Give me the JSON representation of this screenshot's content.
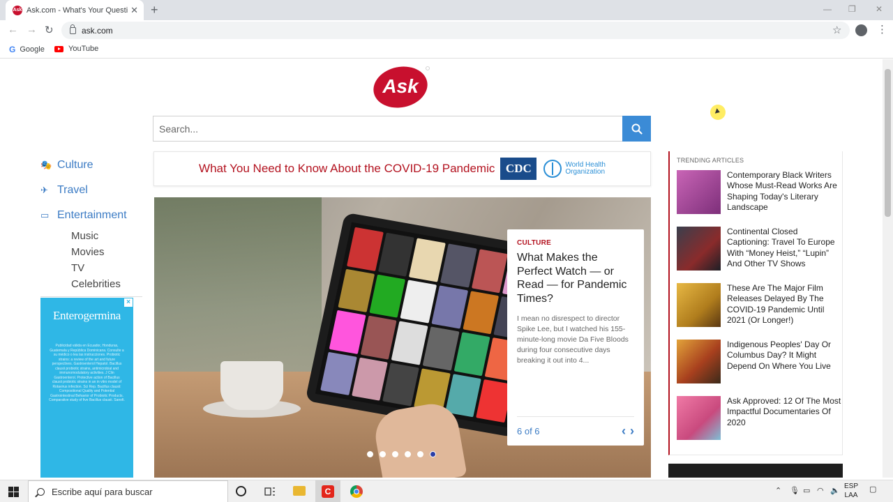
{
  "browser": {
    "tab_title": "Ask.com - What's Your Question?",
    "url": "ask.com",
    "bookmarks": [
      "Google",
      "YouTube"
    ]
  },
  "search": {
    "placeholder": "Search..."
  },
  "logo": {
    "text": "Ask"
  },
  "nav": {
    "items": [
      {
        "label": "Culture",
        "icon": "masks-icon"
      },
      {
        "label": "Travel",
        "icon": "plane-icon"
      },
      {
        "label": "Entertainment",
        "icon": "monitor-icon"
      }
    ],
    "subitems": [
      "Music",
      "Movies",
      "TV",
      "Celebrities"
    ]
  },
  "ad": {
    "brand": "Enterogermina",
    "fine_print": "Publicidad válida en Ecuador, Honduras, Guatemala y República Dominicana. Consulte a su médico o lea las instrucciones. Probiotic strains: a review of the art and future perspectives. Gastroenterol Hepatol. Bacillus clausii probiotic strains, antimicrobial and immunomodulatory activities. J Clin Gastroenterol. Protective action of Bacillus clausii probiotic strains in an in vitro model of Rotavirus infection. Sci Rep. Bacillus clausii: Compositional Quality and Potential Gastrointestinal Behavior of Probiotic Products. Comparative study of five Bacillus clausii. Sanofi.",
    "close_label": "×"
  },
  "covid": {
    "text": "What You Need to Know About the COVID-19 Pandemic",
    "cdc_label": "CDC",
    "who_label_1": "World Health",
    "who_label_2": "Organization"
  },
  "hero": {
    "category": "CULTURE",
    "headline": "What Makes the Perfect Watch — or Read — for Pandemic Times?",
    "excerpt": "I mean no disrespect to director Spike Lee, but I watched his 155-minute-long movie Da Five Bloods during four consecutive days breaking it out into 4...",
    "counter": "6 of 6",
    "prev_label": "‹",
    "next_label": "›",
    "slide_count": 6,
    "active_slide": 6
  },
  "trending": {
    "heading": "TRENDING ARTICLES",
    "items": [
      {
        "title": "Contemporary Black Writers Whose Must-Read Works Are Shaping Today's Literary Landscape",
        "color": "#b84fa8"
      },
      {
        "title": "Continental Closed Captioning: Travel To Europe With “Money Heist,” “Lupin” And Other TV Shows",
        "color": "#2c2f3a"
      },
      {
        "title": "These Are The Major Film Releases Delayed By The COVID-19 Pandemic Until 2021 (Or Longer!)",
        "color": "#d7a233"
      },
      {
        "title": "Indigenous Peoples' Day Or Columbus Day? It Might Depend On Where You Live",
        "color": "#a8401e"
      },
      {
        "title": "Ask Approved: 12 Of The Most Impactful Documentaries Of 2020",
        "color": "#e05a8a"
      }
    ]
  },
  "bottom_ad": {
    "text": ""
  },
  "taskbar": {
    "search_placeholder": "Escribe aquí para buscar",
    "lang_1": "ESP",
    "lang_2": "LAA"
  },
  "colors": {
    "accent_blue": "#3b7bc4",
    "accent_red": "#b3121f",
    "search_button": "#3b8bd6",
    "ad_bg": "#2fb7e6"
  }
}
